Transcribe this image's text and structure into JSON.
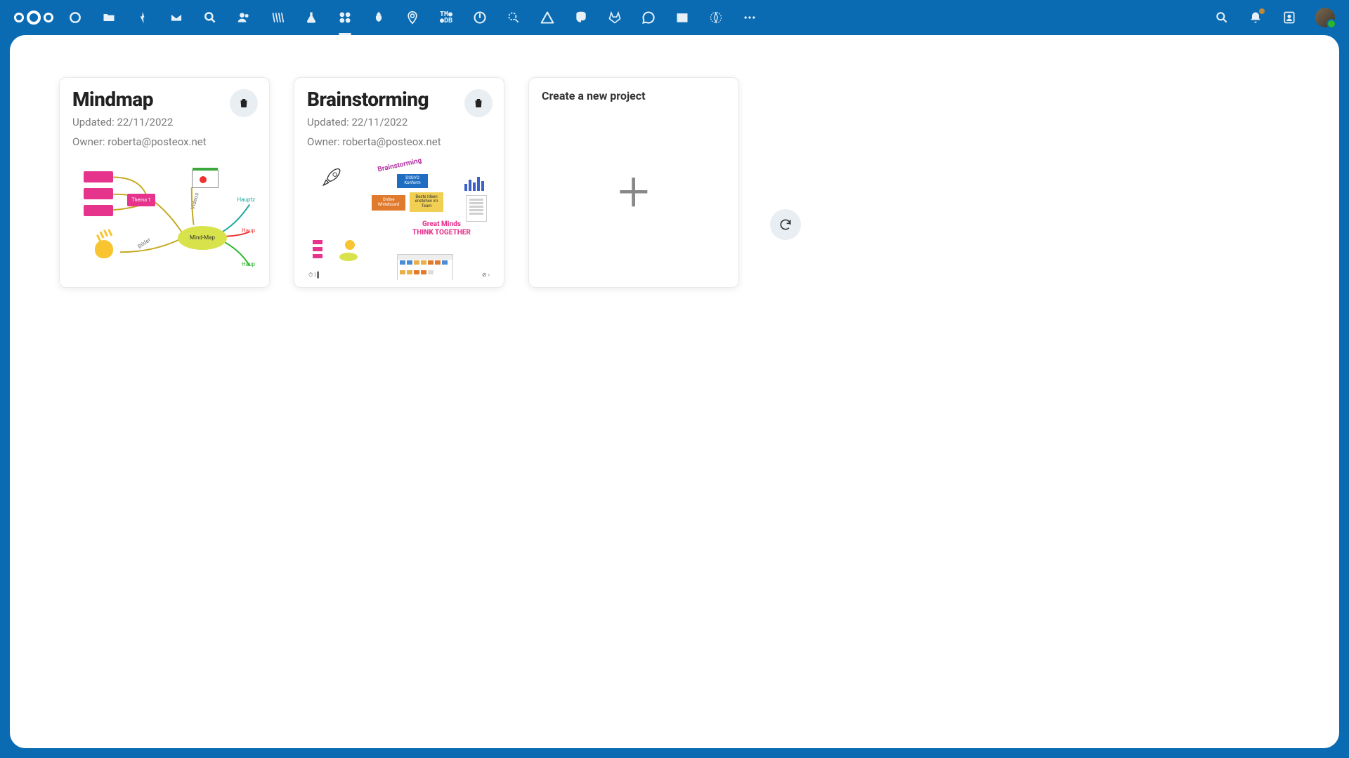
{
  "header": {
    "app_icons": [
      "dashboard",
      "files",
      "activity",
      "mail",
      "search-app",
      "contacts-group",
      "scratch",
      "chemistry",
      "whiteboard",
      "finance",
      "maps",
      "tmdb",
      "power",
      "inspect",
      "warning",
      "mastodon",
      "gitlab",
      "chat",
      "archive",
      "compass",
      "more"
    ],
    "right_icons": [
      "search",
      "notifications",
      "contacts",
      "avatar"
    ]
  },
  "projects": [
    {
      "title": "Mindmap",
      "updated_label": "Updated: 22/11/2022",
      "owner_label": "Owner: roberta@posteox.net",
      "preview": {
        "center_label": "Mind-Map",
        "theme_label": "Thema 1",
        "side_labels": {
          "videos": "Videos",
          "bilder": "Bilder"
        },
        "branch_labels": [
          "Hauptz",
          "Haup",
          "Haup"
        ]
      }
    },
    {
      "title": "Brainstorming",
      "updated_label": "Updated: 22/11/2022",
      "owner_label": "Owner: roberta@posteox.net",
      "preview": {
        "angled_title": "Brainstorming",
        "blue_box": "DSGVO Konform",
        "orange_box": "Online Whiteboard",
        "yellow_box": "Beste Ideen enstehen im Team",
        "slogan_line1": "Great Minds",
        "slogan_line2": "THINK TOGETHER"
      }
    }
  ],
  "create_card": {
    "title": "Create a new project"
  }
}
